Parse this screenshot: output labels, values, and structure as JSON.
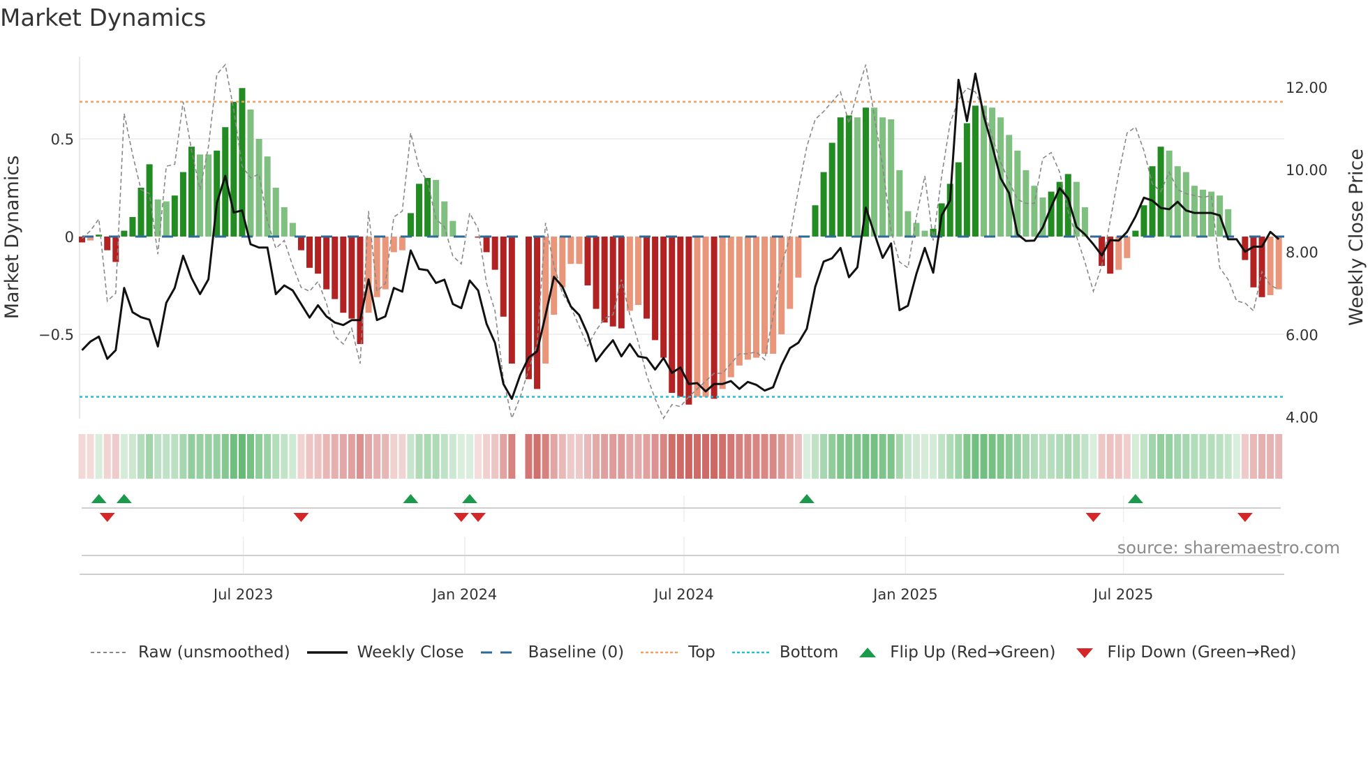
{
  "title": "Market Dynamics",
  "source": "source: sharemaestro.com",
  "colors": {
    "pos_strong": "#228b22",
    "pos_weak": "#7fbf7f",
    "neg_strong": "#b22222",
    "neg_weak": "#e9967a",
    "close": "#111111",
    "raw": "#888888",
    "baseline": "#2b6a99",
    "top": "#f0a060",
    "bottom": "#20c0d0",
    "flip_up": "#1a9a4a",
    "flip_down": "#d62728",
    "strip_pos": "#2ea043",
    "strip_neg": "#c0403c"
  },
  "legend": {
    "raw": "Raw (unsmoothed)",
    "close": "Weekly Close",
    "baseline": "Baseline (0)",
    "top": "Top",
    "bottom": "Bottom",
    "flip_up": "Flip Up (Red→Green)",
    "flip_down": "Flip Down (Green→Red)"
  },
  "chart_data": {
    "type": "bar",
    "title": "Market Dynamics",
    "ylabel": "Market Dynamics",
    "y2label": "Weekly Close Price",
    "start_date": "2023-02-17",
    "interval_days": 7,
    "ylim": [
      -0.93,
      0.92
    ],
    "y2lim": [
      3.96,
      12.75
    ],
    "yticks": [
      {
        "v": 0.5,
        "label": "0.5"
      },
      {
        "v": 0,
        "label": "0"
      },
      {
        "v": -0.5,
        "label": "−0.5"
      }
    ],
    "y2ticks": [
      {
        "v": 12,
        "label": "12.00"
      },
      {
        "v": 10,
        "label": "10.00"
      },
      {
        "v": 8,
        "label": "8.00"
      },
      {
        "v": 6,
        "label": "6.00"
      },
      {
        "v": 4,
        "label": "4.00"
      }
    ],
    "xticks": [
      {
        "date": "2023-07-01",
        "label": "Jul 2023"
      },
      {
        "date": "2024-01-01",
        "label": "Jan 2024"
      },
      {
        "date": "2024-07-01",
        "label": "Jul 2024"
      },
      {
        "date": "2025-01-01",
        "label": "Jan 2025"
      },
      {
        "date": "2025-07-01",
        "label": "Jul 2025"
      }
    ],
    "baseline": 0,
    "top": 0.69,
    "bottom": -0.82,
    "momentum": [
      -0.03,
      -0.02,
      0.01,
      -0.07,
      -0.13,
      0.03,
      0.1,
      0.25,
      0.37,
      0.19,
      0.18,
      0.21,
      0.33,
      0.46,
      0.42,
      0.42,
      0.44,
      0.56,
      0.69,
      0.76,
      0.65,
      0.5,
      0.41,
      0.25,
      0.15,
      0.07,
      -0.07,
      -0.16,
      -0.19,
      -0.27,
      -0.32,
      -0.39,
      -0.42,
      -0.55,
      -0.39,
      -0.31,
      -0.27,
      -0.08,
      -0.07,
      0.12,
      0.27,
      0.3,
      0.29,
      0.18,
      0.08,
      0.0,
      0.0,
      -0.005,
      -0.08,
      -0.17,
      -0.41,
      -0.65,
      null,
      -0.73,
      -0.78,
      -0.65,
      -0.4,
      -0.26,
      -0.14,
      -0.14,
      -0.25,
      -0.37,
      -0.44,
      -0.46,
      -0.47,
      -0.38,
      -0.35,
      -0.42,
      -0.53,
      -0.62,
      -0.8,
      -0.82,
      -0.86,
      -0.82,
      -0.82,
      -0.83,
      -0.78,
      -0.72,
      -0.66,
      -0.63,
      -0.62,
      -0.6,
      -0.6,
      -0.5,
      -0.37,
      -0.21,
      0.005,
      0.16,
      0.33,
      0.48,
      0.61,
      0.62,
      0.61,
      0.66,
      0.66,
      0.61,
      0.6,
      0.34,
      0.13,
      0.07,
      0.03,
      0.04,
      0.17,
      0.27,
      0.38,
      0.58,
      0.67,
      0.67,
      0.66,
      0.61,
      0.52,
      0.44,
      0.34,
      0.26,
      0.2,
      0.23,
      0.28,
      0.32,
      0.28,
      0.15,
      0.0,
      -0.15,
      -0.19,
      -0.17,
      -0.11,
      0.03,
      0.16,
      0.36,
      0.46,
      0.44,
      0.36,
      0.33,
      0.26,
      0.24,
      0.23,
      0.21,
      0.14,
      0.0,
      -0.12,
      -0.26,
      -0.31,
      -0.3,
      -0.27
    ],
    "raw": [
      -0.01,
      0.03,
      0.09,
      -0.33,
      -0.29,
      0.63,
      0.42,
      0.24,
      0.22,
      -0.09,
      0.36,
      0.37,
      0.69,
      0.44,
      0.24,
      0.46,
      0.83,
      0.88,
      0.65,
      0.36,
      0.3,
      0.32,
      0.08,
      -0.06,
      -0.02,
      -0.15,
      -0.26,
      -0.28,
      -0.23,
      -0.34,
      -0.51,
      -0.55,
      -0.47,
      -0.65,
      0.13,
      -0.28,
      -0.24,
      0.1,
      0.13,
      0.53,
      0.35,
      0.28,
      0.09,
      0.05,
      -0.1,
      -0.14,
      0.12,
      0.04,
      -0.24,
      -0.38,
      -0.73,
      -0.93,
      -0.82,
      -0.68,
      -0.55,
      0.07,
      -0.15,
      -0.29,
      -0.36,
      -0.46,
      -0.56,
      -0.48,
      -0.42,
      -0.4,
      -0.22,
      -0.4,
      -0.54,
      -0.71,
      -0.83,
      -0.93,
      -0.86,
      -0.87,
      -0.82,
      -0.78,
      -0.74,
      -0.7,
      -0.7,
      -0.65,
      -0.6,
      -0.6,
      -0.59,
      -0.63,
      -0.41,
      -0.15,
      0.0,
      0.24,
      0.46,
      0.6,
      0.64,
      0.69,
      0.74,
      0.58,
      0.74,
      0.88,
      0.62,
      0.36,
      0.03,
      -0.13,
      -0.16,
      0.1,
      0.31,
      -0.02,
      0.31,
      0.58,
      0.7,
      0.76,
      0.74,
      0.65,
      0.51,
      0.38,
      0.28,
      0.19,
      0.17,
      0.17,
      0.4,
      0.43,
      0.33,
      0.13,
      0.0,
      -0.13,
      -0.28,
      -0.15,
      0.08,
      0.32,
      0.53,
      0.56,
      0.44,
      0.27,
      0.23,
      0.33,
      0.24,
      0.22,
      0.21,
      0.2,
      0.21,
      -0.16,
      -0.22,
      -0.33,
      -0.34,
      -0.38,
      -0.18,
      -0.25,
      -0.27
    ],
    "weekly_close": [
      5.62,
      5.83,
      5.95,
      5.41,
      5.62,
      7.13,
      6.54,
      6.42,
      6.36,
      5.71,
      6.77,
      7.13,
      7.91,
      7.37,
      6.98,
      7.34,
      9.19,
      9.85,
      8.96,
      9.01,
      8.19,
      8.11,
      8.11,
      6.98,
      7.19,
      7.07,
      6.74,
      6.41,
      6.71,
      6.44,
      6.29,
      6.23,
      6.35,
      6.35,
      7.34,
      6.35,
      6.44,
      7.13,
      7.04,
      8.04,
      7.59,
      7.56,
      7.25,
      7.33,
      6.74,
      6.64,
      7.31,
      7.07,
      6.26,
      5.8,
      4.8,
      4.44,
      5.02,
      5.44,
      5.59,
      6.47,
      7.4,
      7.16,
      6.68,
      6.47,
      6.01,
      5.35,
      5.62,
      5.86,
      5.47,
      5.77,
      5.47,
      5.43,
      5.15,
      5.43,
      5.07,
      5.2,
      4.8,
      4.82,
      4.62,
      4.8,
      4.8,
      4.87,
      4.68,
      4.85,
      4.78,
      4.64,
      4.72,
      5.26,
      5.67,
      5.8,
      6.14,
      7.16,
      7.77,
      7.85,
      8.1,
      7.39,
      7.63,
      9.08,
      8.46,
      7.86,
      8.21,
      6.59,
      6.7,
      7.47,
      8.1,
      7.5,
      8.89,
      9.25,
      12.18,
      11.18,
      12.33,
      11.3,
      10.58,
      9.79,
      9.43,
      8.43,
      8.27,
      8.28,
      8.6,
      9.1,
      9.55,
      9.31,
      8.61,
      8.43,
      8.19,
      7.92,
      8.29,
      8.28,
      8.49,
      8.86,
      9.32,
      9.25,
      9.07,
      9.04,
      9.22,
      9.01,
      8.95,
      8.95,
      8.95,
      8.89,
      8.31,
      8.31,
      8.01,
      8.13,
      8.13,
      8.49,
      8.31
    ],
    "flip_up_dates": [
      "2023-03-03",
      "2023-03-24",
      "2023-11-17",
      "2024-01-05",
      "2024-10-11",
      "2025-07-11"
    ],
    "flip_down_dates": [
      "2023-03-10",
      "2023-08-18",
      "2023-12-29",
      "2024-01-12",
      "2025-06-06",
      "2025-10-10"
    ],
    "legend_position": "bottom"
  }
}
